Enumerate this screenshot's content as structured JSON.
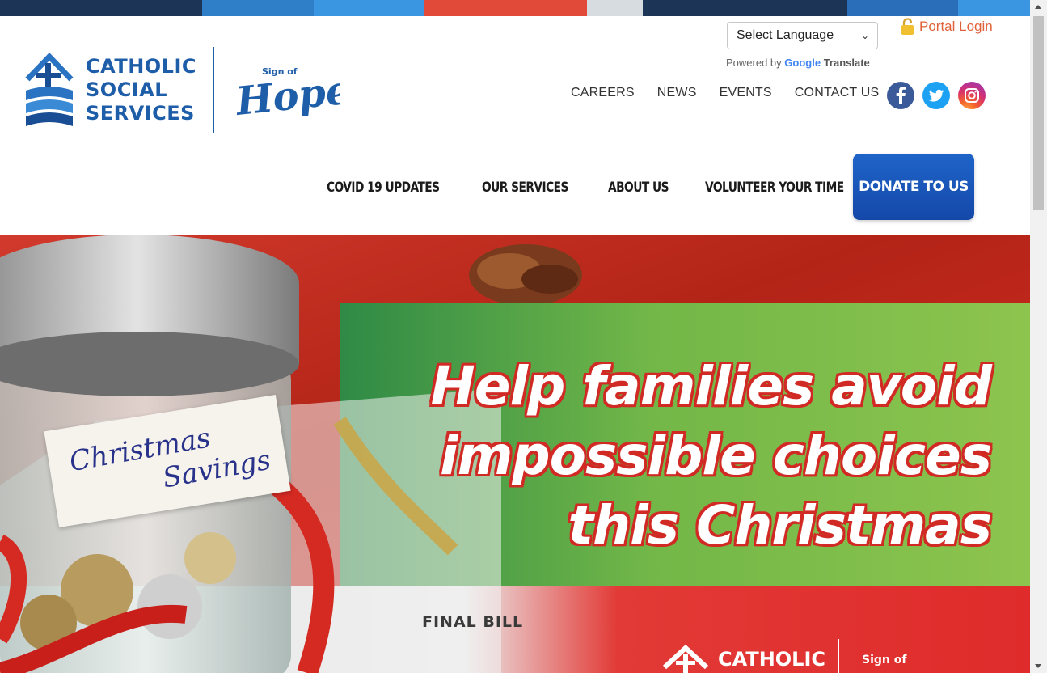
{
  "stripe_colors": [
    "#1c3455",
    "#2e7fc8",
    "#3a96e0",
    "#e14a38",
    "#d7dce1",
    "#1c3455",
    "#2a6db8",
    "#3a96e0"
  ],
  "logo": {
    "line1": "CATHOLIC",
    "line2": "SOCIAL",
    "line3": "SERVICES",
    "hope_small": "Sign of",
    "hope_big": "Hope!"
  },
  "translate": {
    "select_value": "Select Language",
    "powered_by": "Powered by",
    "google": "Google",
    "translate": "Translate"
  },
  "portal_login": "Portal Login",
  "top_nav": [
    "CAREERS",
    "NEWS",
    "EVENTS",
    "CONTACT US"
  ],
  "social": [
    {
      "name": "facebook-icon",
      "glyph": "f",
      "color": "#3b5a9a"
    },
    {
      "name": "twitter-icon",
      "glyph": "t",
      "color": "#1da1f2"
    },
    {
      "name": "instagram-icon",
      "glyph": "◎",
      "color": "#d6306e"
    }
  ],
  "main_nav": [
    "COVID 19 UPDATES",
    "OUR SERVICES",
    "ABOUT US",
    "VOLUNTEER YOUR TIME"
  ],
  "donate_label": "DONATE TO US",
  "hero": {
    "headline_1": "Help families avoid",
    "headline_2": "impossible choices",
    "headline_3": "this Christmas",
    "jar_label_1": "Christmas",
    "jar_label_2": "Savings",
    "final_bill": "FINAL BILL",
    "mini_logo": "CATHOLIC",
    "mini_hope": "Sign of"
  },
  "colors": {
    "brand_blue": "#1e5da8",
    "portal_orange": "#e0623a",
    "donate_blue": "#1a56b8",
    "hero_red": "#d12a24",
    "hero_green": "#72b748"
  }
}
